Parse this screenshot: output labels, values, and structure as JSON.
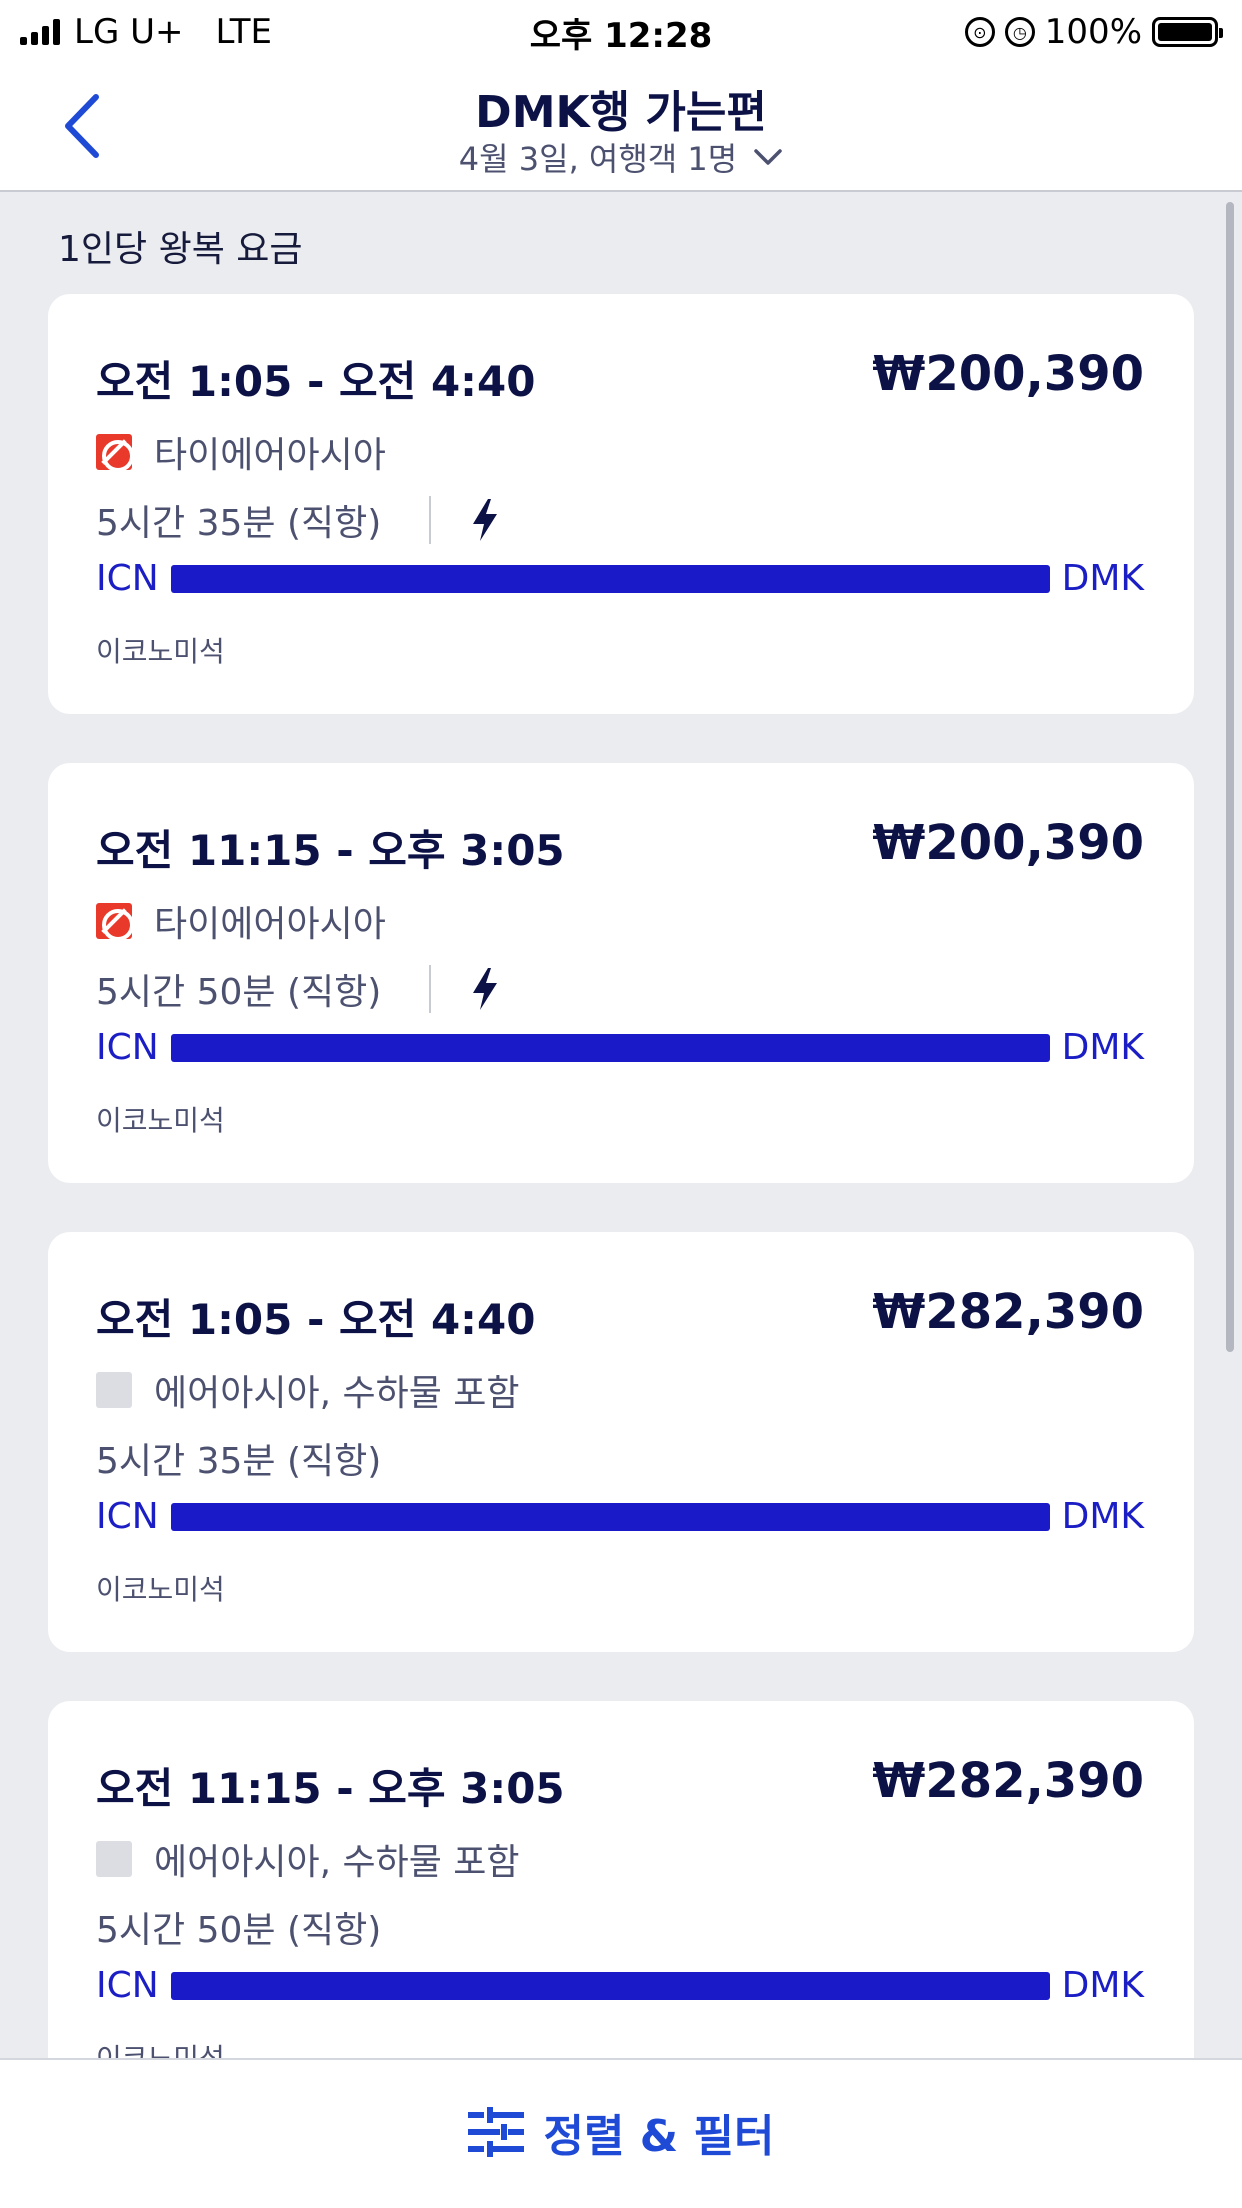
{
  "status_bar": {
    "carrier": "LG U+",
    "network": "LTE",
    "time": "오후 12:28",
    "battery": "100%"
  },
  "header": {
    "title": "DMK행 가는편",
    "subtitle": "4월 3일, 여행객 1명"
  },
  "section_label": "1인당 왕복 요금",
  "flights": [
    {
      "times": "오전 1:05 - 오전 4:40",
      "price": "₩200,390",
      "airline": "타이에어아시아",
      "duration": "5시간 35분 (직항)",
      "origin": "ICN",
      "destination": "DMK",
      "cabin": "이코노미석"
    },
    {
      "times": "오전 11:15 - 오후 3:05",
      "price": "₩200,390",
      "airline": "타이에어아시아",
      "duration": "5시간 50분 (직항)",
      "origin": "ICN",
      "destination": "DMK",
      "cabin": "이코노미석"
    },
    {
      "times": "오전 1:05 - 오전 4:40",
      "price": "₩282,390",
      "airline": "에어아시아, 수하물 포함",
      "duration": "5시간 35분 (직항)",
      "origin": "ICN",
      "destination": "DMK",
      "cabin": "이코노미석"
    },
    {
      "times": "오전 11:15 - 오후 3:05",
      "price": "₩282,390",
      "airline": "에어아시아, 수하물 포함",
      "duration": "5시간 50분 (직항)",
      "origin": "ICN",
      "destination": "DMK",
      "cabin": "이코노미석"
    }
  ],
  "bottom_bar": {
    "filter_label": "정렬 & 필터"
  },
  "colors": {
    "accent": "#1f4ad6",
    "route_bar": "#1a1ac8",
    "background": "#ebecf0"
  }
}
